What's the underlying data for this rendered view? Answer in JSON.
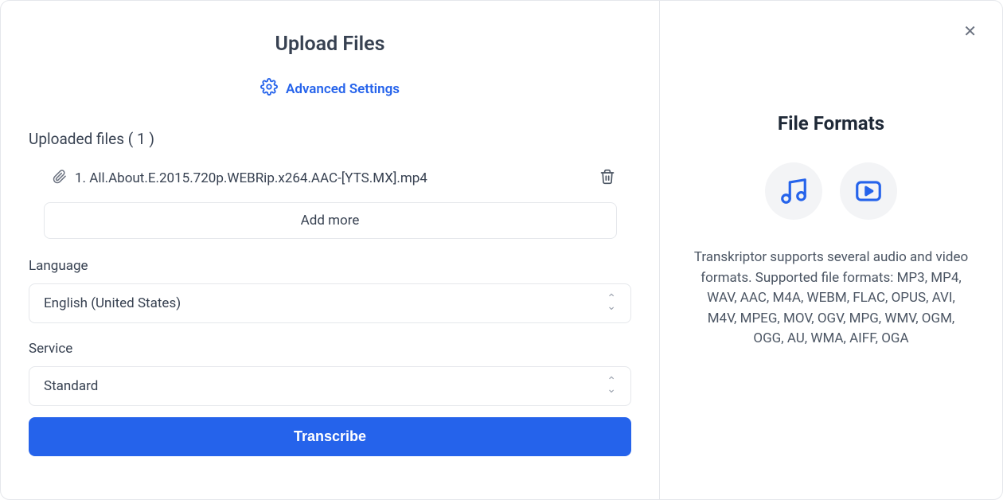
{
  "header": {
    "title": "Upload Files",
    "advanced_settings": "Advanced Settings"
  },
  "uploaded": {
    "label": "Uploaded files ( 1 )",
    "files": [
      {
        "name": "1. All.About.E.2015.720p.WEBRip.x264.AAC-[YTS.MX].mp4"
      }
    ],
    "add_more": "Add more"
  },
  "language": {
    "label": "Language",
    "value": "English (United States)"
  },
  "service": {
    "label": "Service",
    "value": "Standard"
  },
  "action": {
    "transcribe": "Transcribe"
  },
  "sidebar": {
    "title": "File Formats",
    "description": "Transkriptor supports several audio and video formats. Supported file formats: MP3, MP4, WAV, AAC, M4A, WEBM, FLAC, OPUS, AVI, M4V, MPEG, MOV, OGV, MPG, WMV, OGM, OGG, AU, WMA, AIFF, OGA"
  }
}
